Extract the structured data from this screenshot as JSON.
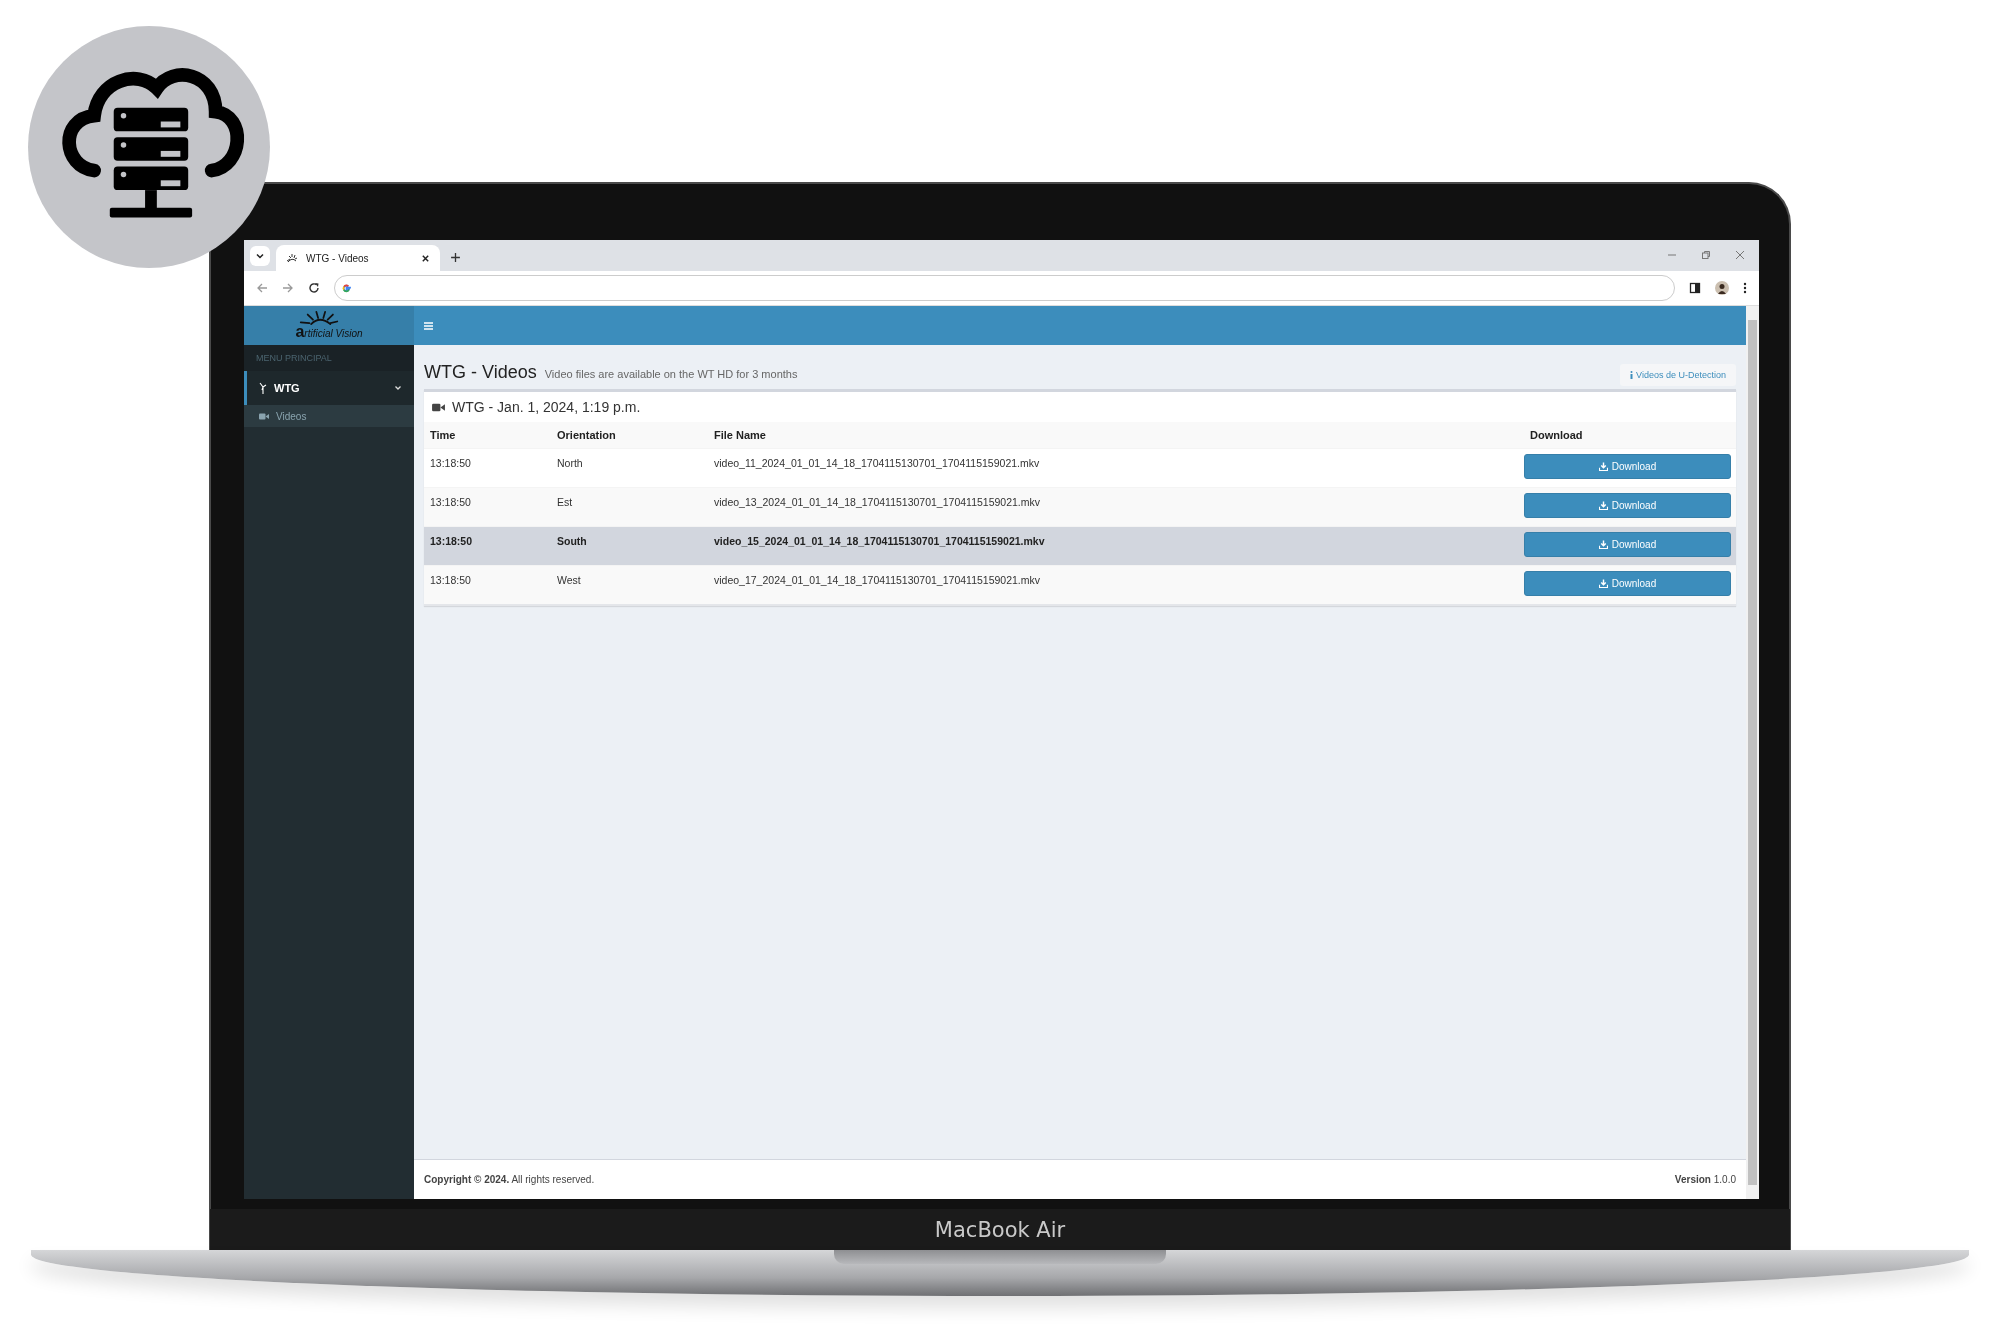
{
  "device_label": "MacBook Air",
  "browser": {
    "tabs": [
      {
        "title": "WTG - Videos",
        "selected": true
      }
    ]
  },
  "sidebar": {
    "logo": "artificial Vision",
    "section_label": "MENU PRINCIPAL",
    "items": [
      {
        "label": "WTG",
        "expanded": true,
        "selected": true,
        "children": [
          {
            "label": "Videos",
            "selected": false
          }
        ]
      }
    ]
  },
  "page": {
    "title": "WTG - Videos",
    "subtitle": "Video files are available on the WT HD for 3 months",
    "info_link": "Videos de U-Detection"
  },
  "box": {
    "title": "WTG - Jan. 1, 2024, 1:19 p.m.",
    "columns": [
      "Time",
      "Orientation",
      "File Name",
      "Download"
    ],
    "rows": [
      {
        "time": "13:18:50",
        "orientation": "North",
        "file_name": "video_11_2024_01_01_14_18_1704115130701_1704115159021.mkv",
        "action": "Download",
        "selected": false
      },
      {
        "time": "13:18:50",
        "orientation": "Est",
        "file_name": "video_13_2024_01_01_14_18_1704115130701_1704115159021.mkv",
        "action": "Download",
        "selected": false
      },
      {
        "time": "13:18:50",
        "orientation": "South",
        "file_name": "video_15_2024_01_01_14_18_1704115130701_1704115159021.mkv",
        "action": "Download",
        "selected": true
      },
      {
        "time": "13:18:50",
        "orientation": "West",
        "file_name": "video_17_2024_01_01_14_18_1704115130701_1704115159021.mkv",
        "action": "Download",
        "selected": false
      }
    ]
  },
  "footer": {
    "copyright": "**Copyright © 2024.** All rights reserved.",
    "version": "**Version** 1.0.0"
  }
}
